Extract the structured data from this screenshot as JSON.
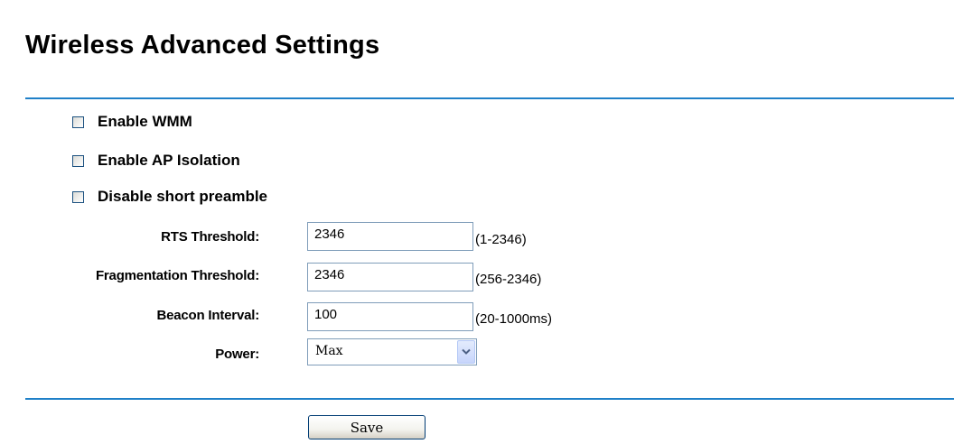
{
  "page": {
    "title": "Wireless Advanced Settings"
  },
  "options": {
    "wmm": {
      "label": "Enable WMM",
      "checked": false
    },
    "ap_isolation": {
      "label": "Enable AP Isolation",
      "checked": false
    },
    "short_preamble": {
      "label": "Disable short preamble",
      "checked": false
    }
  },
  "fields": {
    "rts": {
      "label": "RTS Threshold:",
      "value": "2346",
      "hint": "(1-2346)"
    },
    "fragmentation": {
      "label": "Fragmentation Threshold:",
      "value": "2346",
      "hint": "(256-2346)"
    },
    "beacon": {
      "label": "Beacon Interval:",
      "value": "100",
      "hint": "(20-1000ms)"
    },
    "power": {
      "label": "Power:",
      "value": "Max"
    }
  },
  "actions": {
    "save_label": "Save"
  },
  "icons": {
    "select_arrow": "chevron-down-icon"
  },
  "colors": {
    "divider": "#1f80c8",
    "input_border": "#7f9db9",
    "button_border": "#003c74"
  }
}
